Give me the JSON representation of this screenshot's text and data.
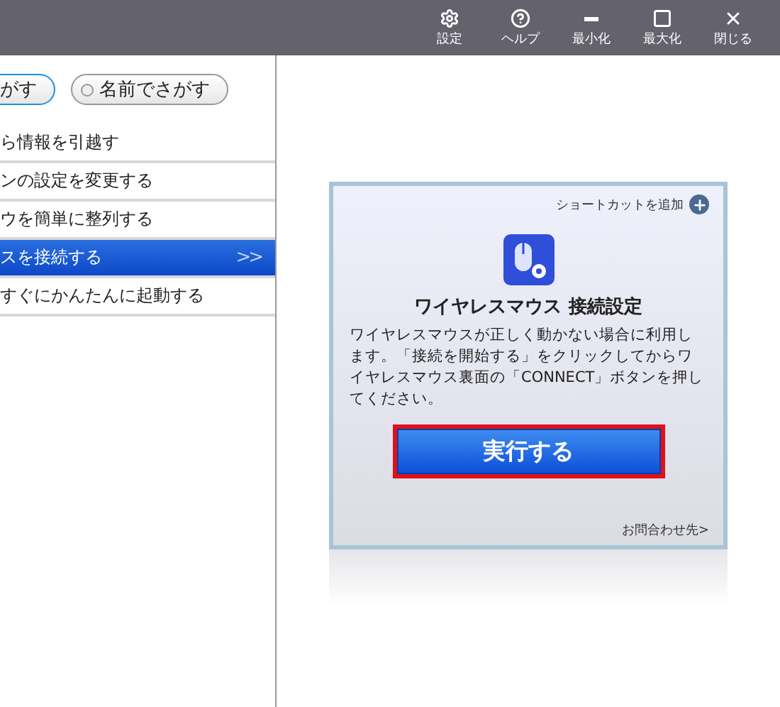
{
  "toolbar": [
    {
      "kind": "settings",
      "label": "設定"
    },
    {
      "kind": "help",
      "label": "ヘルプ"
    },
    {
      "kind": "minimize",
      "label": "最小化"
    },
    {
      "kind": "maximize",
      "label": "最大化"
    },
    {
      "kind": "close",
      "label": "閉じる"
    }
  ],
  "search_modes": [
    {
      "label": "がす",
      "selected": true
    },
    {
      "label": "名前でさがす",
      "selected": false
    }
  ],
  "menu_items": [
    {
      "label": "ら情報を引越す",
      "selected": false
    },
    {
      "label": "ンの設定を変更する",
      "selected": false
    },
    {
      "label": "ウを簡単に整列する",
      "selected": false
    },
    {
      "label": "スを接続する",
      "selected": true,
      "arrow": ">>"
    },
    {
      "label": "すぐにかんたんに起動する",
      "selected": false
    }
  ],
  "card": {
    "shortcut": "ショートカットを追加",
    "title": "ワイヤレスマウス 接続設定",
    "description": "ワイヤレスマウスが正しく動かない場合に利用します。「接続を開始する」をクリックしてからワイヤレスマウス裏面の「CONNECT」ボタンを押してください。",
    "button": "実行する",
    "highlighted": true,
    "contact": "お問合わせ先>"
  }
}
